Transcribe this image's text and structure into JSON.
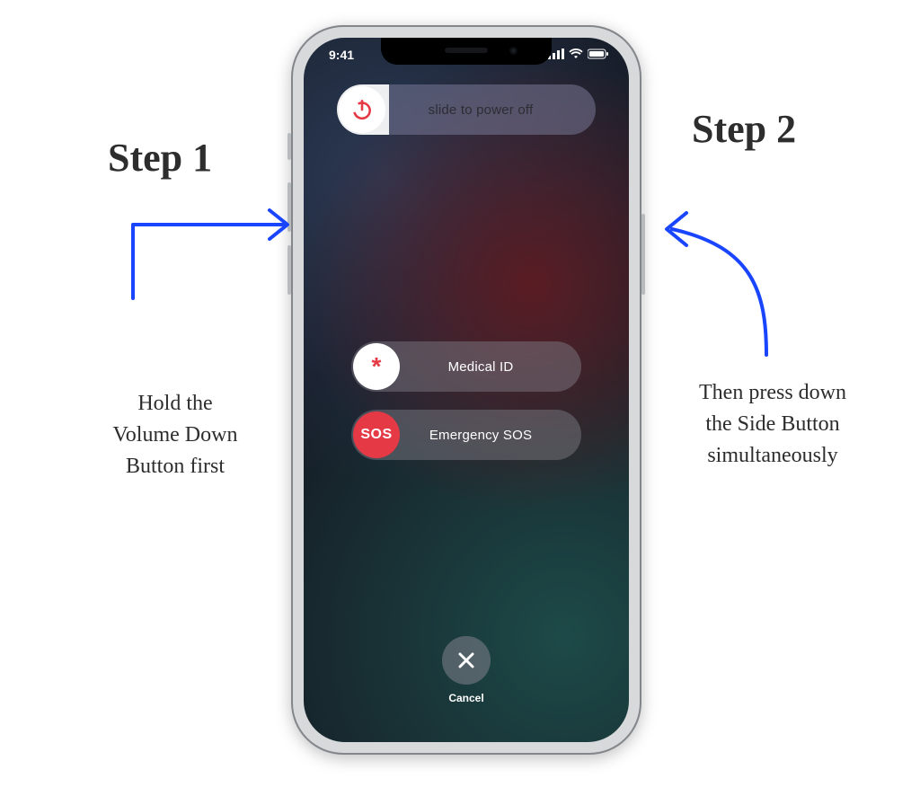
{
  "statusbar": {
    "time": "9:41"
  },
  "power": {
    "label": "slide to power off"
  },
  "medical": {
    "label": "Medical ID",
    "icon_glyph": "*"
  },
  "sos": {
    "label": "Emergency SOS",
    "icon_glyph": "SOS"
  },
  "cancel": {
    "label": "Cancel"
  },
  "annotations": {
    "step1": {
      "title": "Step 1",
      "body": "Hold the\nVolume Down\nButton first"
    },
    "step2": {
      "title": "Step 2",
      "body": "Then press down\nthe Side Button\nsimultaneously"
    }
  }
}
